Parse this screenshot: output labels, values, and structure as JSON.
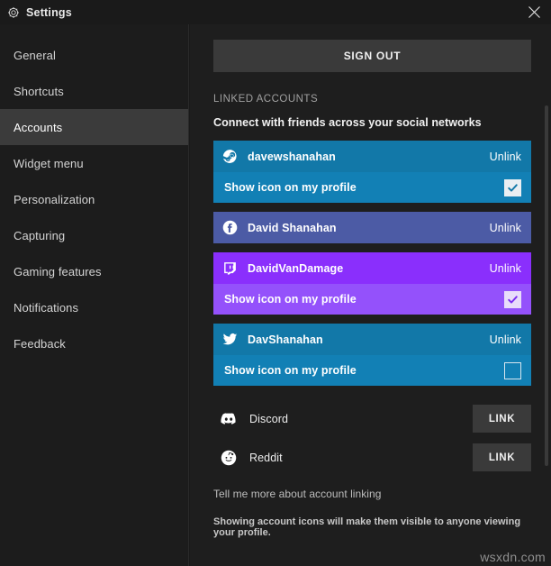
{
  "titlebar": {
    "title": "Settings",
    "gear_icon": "gear-icon",
    "close_icon": "close-icon"
  },
  "sidebar": {
    "items": [
      {
        "label": "General",
        "active": false
      },
      {
        "label": "Shortcuts",
        "active": false
      },
      {
        "label": "Accounts",
        "active": true
      },
      {
        "label": "Widget menu",
        "active": false
      },
      {
        "label": "Personalization",
        "active": false
      },
      {
        "label": "Capturing",
        "active": false
      },
      {
        "label": "Gaming features",
        "active": false
      },
      {
        "label": "Notifications",
        "active": false
      },
      {
        "label": "Feedback",
        "active": false
      }
    ]
  },
  "main": {
    "sign_out_label": "SIGN OUT",
    "section_label": "LINKED ACCOUNTS",
    "section_subtitle": "Connect with friends across your social networks",
    "toggle_label": "Show icon on my profile",
    "unlink_label": "Unlink",
    "link_label": "LINK",
    "help_link": "Tell me more about account linking",
    "footnote": "Showing account icons will make them visible to anyone viewing your profile.",
    "linked_accounts": [
      {
        "service": "steam",
        "icon": "steam-icon",
        "username": "davewshanahan",
        "bg": "#1278a8",
        "row_bg": "#1280b5",
        "show_icon_checked": true,
        "check_color": "#1278a8",
        "has_toggle": true
      },
      {
        "service": "facebook",
        "icon": "facebook-icon",
        "username": "David Shanahan",
        "bg": "#4c5ba5",
        "row_bg": "#4c5ba5",
        "show_icon_checked": false,
        "check_color": "#4c5ba5",
        "has_toggle": false
      },
      {
        "service": "twitch",
        "icon": "twitch-icon",
        "username": "DavidVanDamage",
        "bg": "#8a2ffc",
        "row_bg": "#9451fb",
        "show_icon_checked": true,
        "check_color": "#7a2bf0",
        "has_toggle": true
      },
      {
        "service": "twitter",
        "icon": "twitter-icon",
        "username": "DavShanahan",
        "bg": "#1278a8",
        "row_bg": "#1280b5",
        "show_icon_checked": false,
        "check_color": "#1278a8",
        "has_toggle": true
      }
    ],
    "unlinked_accounts": [
      {
        "service": "discord",
        "icon": "discord-icon",
        "name": "Discord"
      },
      {
        "service": "reddit",
        "icon": "reddit-icon",
        "name": "Reddit"
      }
    ]
  },
  "watermark": "wsxdn.com",
  "colors": {
    "window_bg": "#1a1a1a",
    "sidebar_bg": "#1c1c1c",
    "content_bg": "#1e1e1e",
    "active_item": "#3b3b3b",
    "button_bg": "#3a3a3a",
    "steam_blue": "#1278a8",
    "facebook_blue": "#4c5ba5",
    "twitch_purple": "#8a2ffc",
    "twitter_blue": "#1278a8"
  }
}
